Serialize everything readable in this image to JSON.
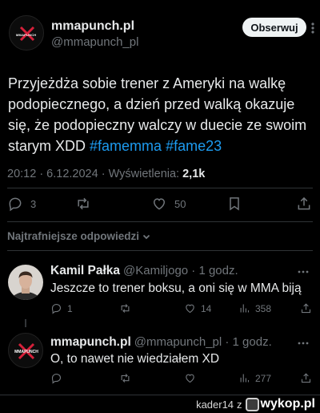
{
  "header": {
    "name": "mmapunch.pl",
    "handle": "@mmapunch_pl",
    "follow_label": "Obserwuj",
    "more_icon": "more-icon",
    "logo_text": "MMAPUNCH"
  },
  "tweet": {
    "text_before": "Przyjeżdża sobie trener z Ameryki na walkę podopiecznego, a dzień przed walką okazuje się, że podopieczny walczy w duecie ze swoim starym XDD ",
    "hashtag1": "#famemma",
    "hashtag2": "#fame23",
    "meta_prefix": "20:12 · 6.12.2024 · Wyświetlenia: ",
    "views": "2,1k",
    "replies": "3",
    "likes": "50"
  },
  "sort_label": "Najtrafniejsze odpowiedzi",
  "replies": [
    {
      "name": "Kamil Pałka",
      "handle": "@Kamiljogo · 1 godz.",
      "text": "Jeszcze to trener boksu, a oni się w MMA biją",
      "replies": "1",
      "likes": "14",
      "views": "358"
    },
    {
      "name": "mmapunch.pl",
      "handle": "@mmapunch_pl · 1 godz.",
      "text": "O, to nawet nie wiedziałem XD",
      "views": "277"
    }
  ],
  "watermark": {
    "user": "kader14",
    "z": "z",
    "site": "wykop.pl"
  },
  "colors": {
    "background": "#000000",
    "hashtag": "#1d9bf0",
    "muted": "#71767b",
    "text": "#e7e9ea",
    "follow_bg": "#eff3f4"
  }
}
